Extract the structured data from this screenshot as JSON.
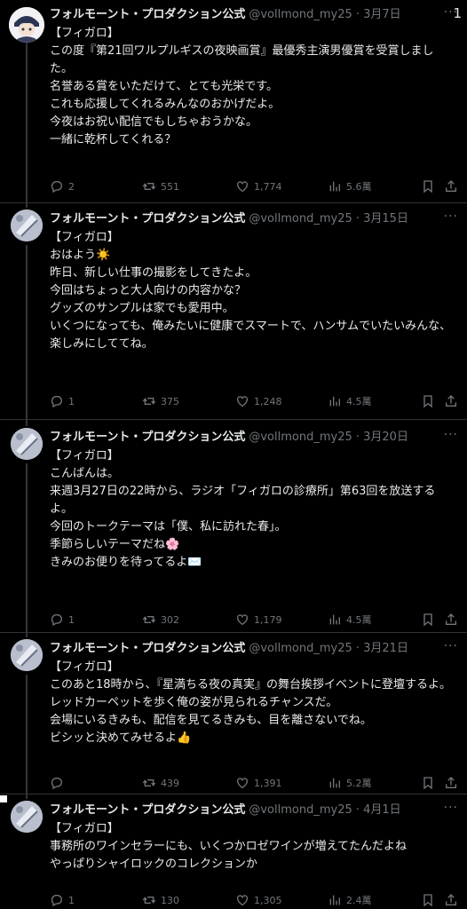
{
  "corner_label": "1",
  "tweets": [
    {
      "name": "フォルモーント・プロダクション公式",
      "handle": "@vollmond_my25 · 3月7日",
      "lines": [
        "【フィガロ】",
        "この度『第21回ワルプルギスの夜映画賞』最優秀主演男優賞を受賞しました。",
        "名誉ある賞をいただけて、とても光栄です。",
        "",
        "これも応援してくれるみんなのおかげだよ。",
        "今夜はお祝い配信でもしちゃおうかな。",
        "",
        "一緒に乾杯してくれる？"
      ],
      "replies": "2",
      "retweets": "551",
      "likes": "1,774",
      "views": "5.6萬"
    },
    {
      "name": "フォルモーント・プロダクション公式",
      "handle": "@vollmond_my25 · 3月15日",
      "lines": [
        "【フィガロ】",
        "",
        "おはよう☀️",
        "",
        "昨日、新しい仕事の撮影をしてきたよ。",
        "今回はちょっと大人向けの内容かな？",
        "",
        "グッズのサンプルは家でも愛用中。",
        "いくつになっても、俺みたいに健康でスマートで、ハンサムでいたいみんな、楽しみにしててね。"
      ],
      "replies": "1",
      "retweets": "375",
      "likes": "1,248",
      "views": "4.5萬"
    },
    {
      "name": "フォルモーント・プロダクション公式",
      "handle": "@vollmond_my25 · 3月20日",
      "lines": [
        "【フィガロ】",
        "",
        "こんばんは。",
        "来週3月27日の22時から、ラジオ「フィガロの診療所」第63回を放送するよ。",
        "",
        "今回のトークテーマは「僕、私に訪れた春」。",
        "季節らしいテーマだね🌸",
        "",
        "きみのお便りを待ってるよ✉️"
      ],
      "replies": "1",
      "retweets": "302",
      "likes": "1,179",
      "views": "4.5萬"
    },
    {
      "name": "フォルモーント・プロダクション公式",
      "handle": "@vollmond_my25 · 3月21日",
      "lines": [
        "【フィガロ】",
        "",
        "このあと18時から、『星満ちる夜の真実』の舞台挨拶イベントに登壇するよ。",
        "レッドカーペットを歩く俺の姿が見られるチャンスだ。",
        "会場にいるきみも、配信を見てるきみも、目を離さないでね。",
        "",
        "ビシッと決めてみせるよ👍"
      ],
      "replies": "",
      "retweets": "439",
      "likes": "1,391",
      "views": "5.2萬"
    },
    {
      "name": "フォルモーント・プロダクション公式",
      "handle": "@vollmond_my25 · 4月1日",
      "lines": [
        "【フィガロ】",
        "",
        "事務所のワインセラーにも、いくつかロゼワインが増えてたんだよね",
        "やっぱりシャイロックのコレクションか"
      ],
      "replies": "1",
      "retweets": "130",
      "likes": "1,305",
      "views": "2.4萬"
    }
  ],
  "icons": {
    "reply": "reply-icon",
    "retweet": "retweet-icon",
    "like": "heart-icon",
    "views": "views-icon",
    "bookmark": "bookmark-icon",
    "share": "share-icon",
    "more": "more-icon"
  }
}
